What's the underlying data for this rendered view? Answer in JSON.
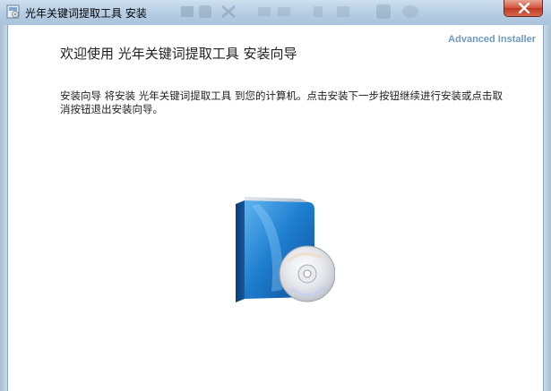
{
  "window": {
    "title": "光年关键词提取工具 安装"
  },
  "header": {
    "brand": "Advanced Installer",
    "heading": "欢迎使用  光年关键词提取工具  安装向导"
  },
  "body": {
    "description": "安装向导  将安装  光年关键词提取工具  到您的计算机。点击安装下一步按钮继续进行安装或点击取消按钮退出安装向导。"
  },
  "icons": {
    "app": "installer-app-icon",
    "close": "close-icon",
    "graphic": "software-box-with-cd"
  },
  "colors": {
    "brand": "#6c9ac4",
    "close_button": "#c9462d",
    "box_blue": "#1f6fb5"
  }
}
